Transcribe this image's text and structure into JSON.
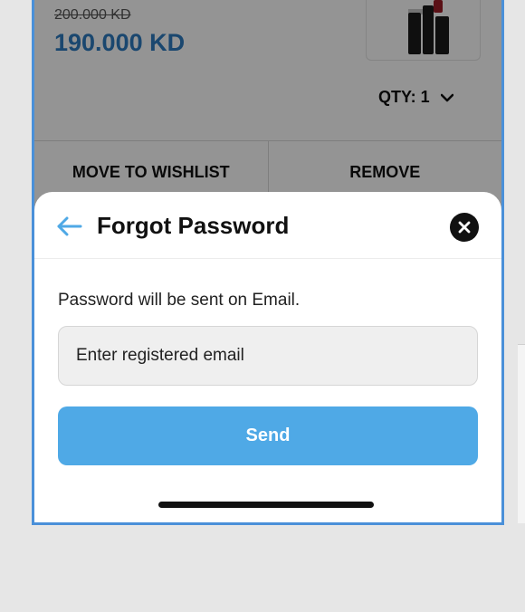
{
  "cart_item": {
    "old_price": "200.000 KD",
    "new_price": "190.000 KD",
    "qty_label": "QTY: 1",
    "move_to_wishlist_label": "MOVE TO WISHLIST",
    "remove_label": "REMOVE",
    "product_image_icon": "lipstick-product-image"
  },
  "sheet": {
    "title": "Forgot Password",
    "back_icon": "arrow-left-icon",
    "close_icon": "close-x-icon",
    "helper_text": "Password will be sent on Email.",
    "email_placeholder": "Enter registered email",
    "email_value": "",
    "send_label": "Send"
  },
  "colors": {
    "accent": "#4fa9e6",
    "price": "#2e7bbf",
    "frame_border": "#4a90d9"
  }
}
